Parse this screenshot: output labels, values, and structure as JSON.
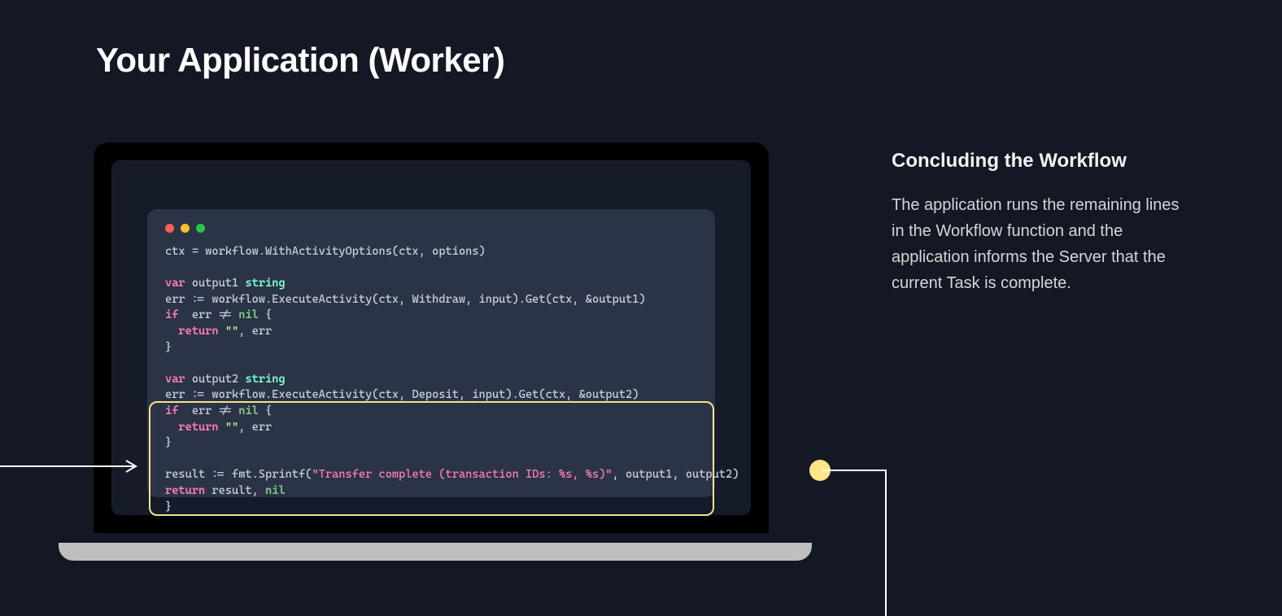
{
  "title": "Your Application (Worker)",
  "sidebar": {
    "title": "Concluding the Workflow",
    "text": "The application runs the remaining lines in the Workflow function and the application informs the Server that the current Task is complete."
  },
  "code": {
    "line1_pre": "ctx = workflow.WithActivityOptions(ctx, options)",
    "line3a": "var",
    "line3b": " output1 ",
    "line3c": "string",
    "line4": "err := workflow.ExecuteActivity(ctx, Withdraw, input).Get(ctx, &output1)",
    "line5a": "if",
    "line5b": "  err != ",
    "line5c": "nil",
    "line5d": " {",
    "line6a": "  ",
    "line6b": "return",
    "line6c": " ",
    "line6d": "\"\"",
    "line6e": ", err",
    "line7": "}",
    "line9a": "var",
    "line9b": " output2 ",
    "line9c": "string",
    "line10": "err := workflow.ExecuteActivity(ctx, Deposit, input).Get(ctx, &output2)",
    "line11a": "if",
    "line11b": "  err != ",
    "line11c": "nil",
    "line11d": " {",
    "line12a": "  ",
    "line12b": "return",
    "line12c": " ",
    "line12d": "\"\"",
    "line12e": ", err",
    "line13": "}",
    "line15a": "result := fmt.Sprintf(",
    "line15b": "\"Transfer complete (transaction IDs: %s, %s)\"",
    "line15c": ", output1, output2)",
    "line16a": "return",
    "line16b": " result, ",
    "line16c": "nil",
    "line17": "}"
  }
}
